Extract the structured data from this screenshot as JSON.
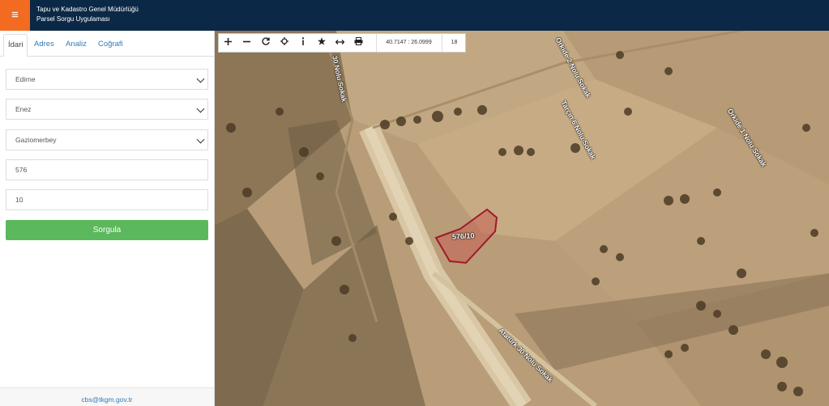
{
  "header": {
    "menu_icon": "≡",
    "title_line1": "Tapu ve Kadastro Genel Müdürlüğü",
    "title_line2": "Parsel Sorgu Uygulaması",
    "background_color": "#0b2846",
    "accent_color": "#f26b21"
  },
  "sidebar": {
    "tabs": [
      {
        "label": "İdari",
        "active": true
      },
      {
        "label": "Adres",
        "active": false
      },
      {
        "label": "Analiz",
        "active": false
      },
      {
        "label": "Coğrafi",
        "active": false
      }
    ],
    "fields": {
      "province": "Edirne",
      "district": "Enez",
      "neighborhood": "Gaziomerbey",
      "block": "576",
      "parcel": "10"
    },
    "submit_label": "Sorgula",
    "submit_color": "#5cb85c",
    "footer_email": "cbs@tkgm.gov.tr"
  },
  "map": {
    "toolbar": {
      "icons": [
        "plus-icon",
        "minus-icon",
        "refresh-icon",
        "locate-icon",
        "info-icon",
        "star-icon",
        "measure-icon",
        "print-icon"
      ],
      "coordinates": "40.7147 : 26.0999",
      "zoom_level": "18"
    },
    "streets": [
      "30 Nolu Sokak",
      "Orkide 2 Nolu Sokak",
      "Tarçın 6 Nolu Sokak",
      "Orkide 1 Nolu Sokak",
      "Atatürk 30 Nolu Sokak"
    ],
    "parcel_label": "576/10",
    "parcel_color": "#a0192b"
  }
}
